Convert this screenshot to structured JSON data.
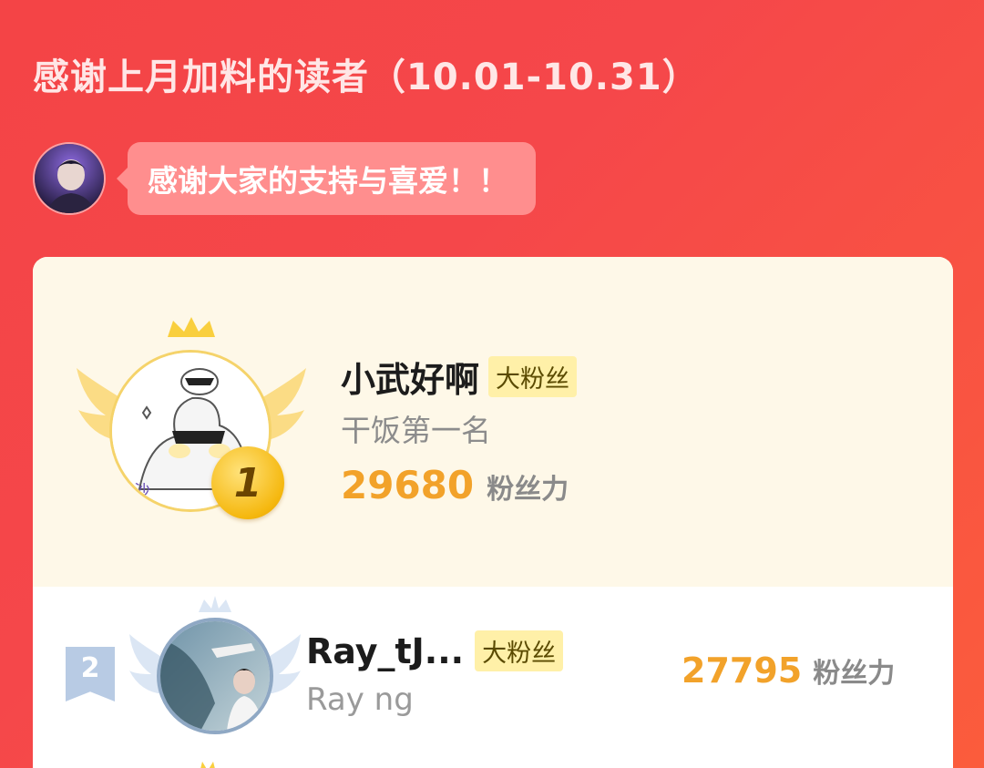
{
  "header": {
    "title": "感谢上月加料的读者（10.01-10.31）"
  },
  "author": {
    "message": "感谢大家的支持与喜爱！！"
  },
  "leaderboard": {
    "score_unit": "粉丝力",
    "entries": [
      {
        "rank": "1",
        "name": "小武好啊",
        "tag": "大粉丝",
        "signature": "干饭第一名",
        "score": "29680"
      },
      {
        "rank": "2",
        "name": "Ray_tJ...",
        "tag": "大粉丝",
        "signature": "Ray ng",
        "score": "27795"
      }
    ]
  },
  "colors": {
    "background": "#f44446",
    "card": "#fef8e8",
    "score": "#f2a22a",
    "tag_bg": "#fff0a8",
    "gold": "#f5b80f",
    "silver": "#b8cbe4"
  },
  "icons": [
    "crown-icon",
    "wings-icon",
    "gold-medal-icon",
    "rank-flag-icon"
  ]
}
